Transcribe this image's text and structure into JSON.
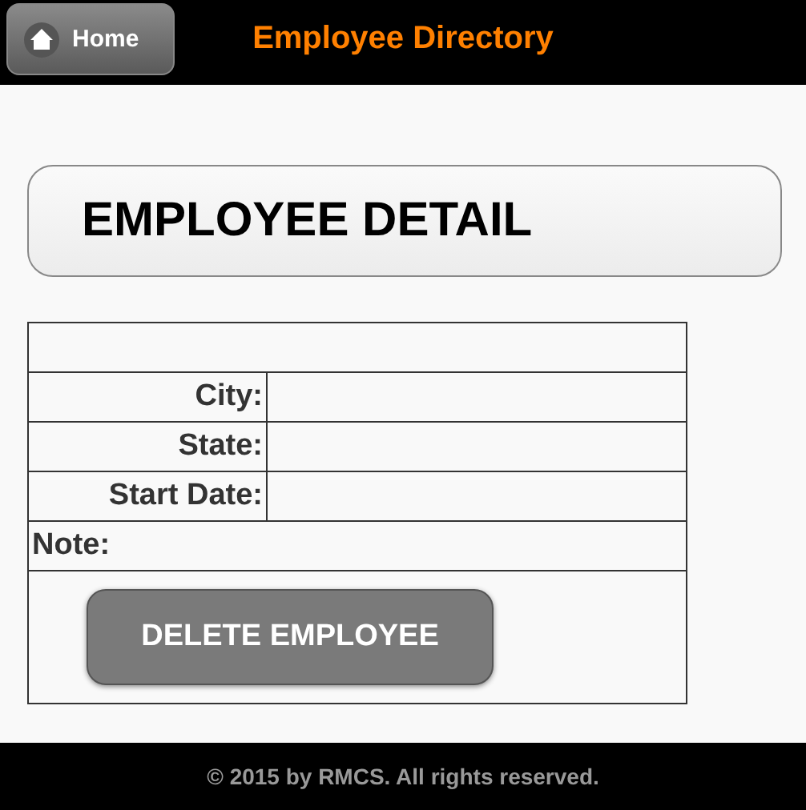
{
  "header": {
    "home_button": "Home",
    "title": "Employee Directory"
  },
  "heading": "EMPLOYEE DETAIL",
  "detail_table": {
    "fields": [
      {
        "label": "City:"
      },
      {
        "label": "State:"
      },
      {
        "label": "Start Date:"
      }
    ],
    "note_label": "Note:",
    "delete_button": "DELETE EMPLOYEE"
  },
  "footer": "© 2015 by RMCS. All rights reserved."
}
